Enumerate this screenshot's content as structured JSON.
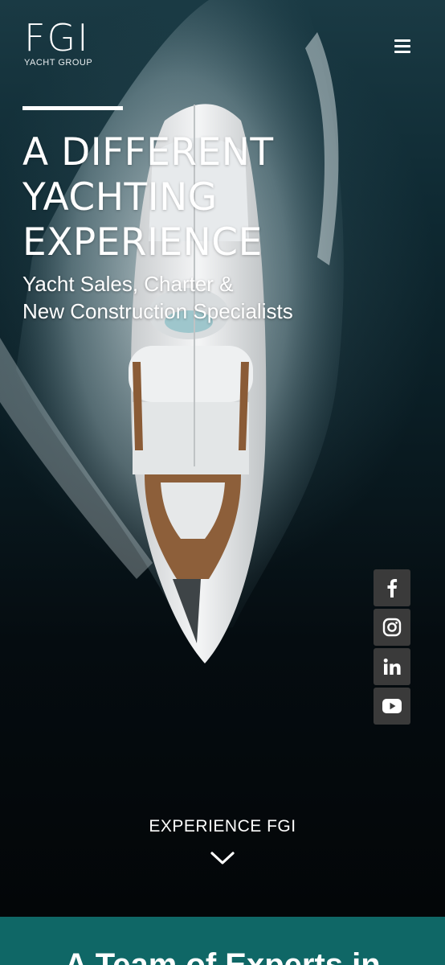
{
  "header": {
    "logo_mark": "FGI",
    "logo_sub": "YACHT GROUP",
    "menu_icon": "hamburger-menu-icon"
  },
  "hero": {
    "headline": [
      "A DIFFERENT",
      "YACHTING",
      "EXPERIENCE"
    ],
    "subhead": [
      "Yacht Sales, Charter &",
      "New Construction Specialists"
    ],
    "cta_label": "EXPERIENCE FGI",
    "cta_icon": "chevron-down-icon"
  },
  "social": [
    {
      "icon": "facebook-icon"
    },
    {
      "icon": "instagram-icon"
    },
    {
      "icon": "linkedin-icon"
    },
    {
      "icon": "youtube-icon"
    }
  ],
  "section": {
    "title": "A Team of Experts in"
  },
  "colors": {
    "teal_band": "#0f6766",
    "social_button": "#3a3a3a",
    "text": "#ffffff"
  }
}
